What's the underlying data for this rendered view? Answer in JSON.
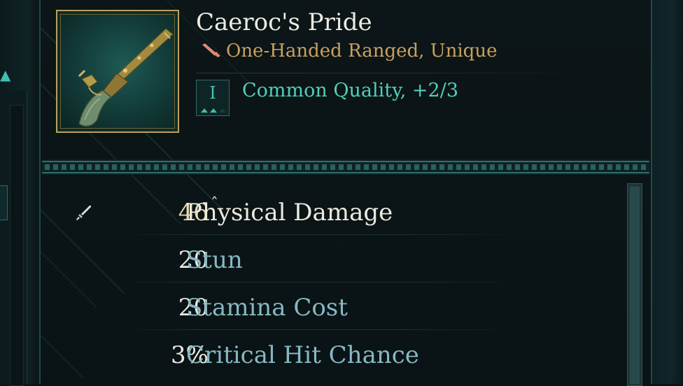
{
  "item": {
    "name": "Caeroc's Pride",
    "type_label": "One-Handed Ranged, Unique",
    "type_icon": "pistol-icon",
    "quality_tier": "I",
    "quality_text": "Common Quality, +2/3",
    "quality_pips": {
      "filled": 2,
      "total": 3
    }
  },
  "stats": [
    {
      "value": "46",
      "label": "Physical Damage",
      "icon": "sword-icon",
      "value_color": "#e9dbb0",
      "label_color": "#eceadf",
      "upgrade_marker": "ˆ"
    },
    {
      "value": "20",
      "label": "Stun",
      "value_color": "#eceadf",
      "label_color": "#86b8c4"
    },
    {
      "value": "20",
      "label": "Stamina Cost",
      "value_color": "#eceadf",
      "label_color": "#86b8c4"
    },
    {
      "value": "3%",
      "label": "Critical Hit Chance",
      "value_color": "#eceadf",
      "label_color": "#86b8c4"
    }
  ],
  "colors": {
    "gold": "#c8a15e",
    "teal": "#4fcfbd",
    "frame_gold": "#b9a25a"
  }
}
